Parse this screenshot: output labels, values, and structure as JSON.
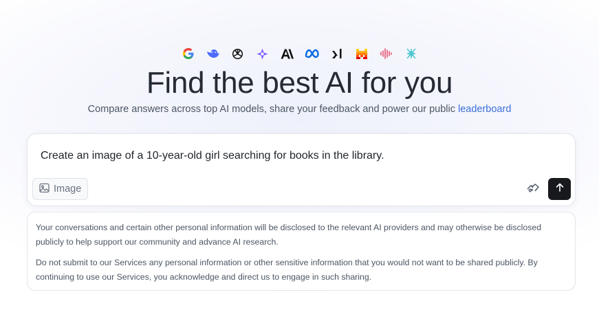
{
  "logos": [
    {
      "icon": "google-icon",
      "color": "#4285F4"
    },
    {
      "icon": "deepseek-icon",
      "color": "#4D6BFE"
    },
    {
      "icon": "openai-icon",
      "color": "#111111"
    },
    {
      "icon": "gemini-star-icon",
      "color": "#7C5CFF"
    },
    {
      "icon": "anthropic-icon",
      "color": "#111111"
    },
    {
      "icon": "meta-icon",
      "color": "#0668E1"
    },
    {
      "icon": "xai-icon",
      "color": "#111111"
    },
    {
      "icon": "mistral-icon",
      "color": "#F7A21B"
    },
    {
      "icon": "audio-wave-icon",
      "color": "#E5536F"
    },
    {
      "icon": "qwen-icon",
      "color": "#4DC6CF"
    }
  ],
  "title": "Find the best AI for you",
  "subtitle": {
    "text": "Compare answers across top AI models, share your feedback and power our public ",
    "link": "leaderboard"
  },
  "composer": {
    "prompt": "Create an image of a 10-year-old girl searching for books in the library.",
    "image_button": "Image"
  },
  "disclaimer": {
    "p1": "Your conversations and certain other personal information will be disclosed to the relevant AI providers and may otherwise be disclosed publicly to help support our community and advance AI research.",
    "p2": "Do not submit to our Services any personal information or other sensitive information that you would not want to be shared publicly. By continuing to use our Services, you acknowledge and direct us to engage in such sharing."
  },
  "colors": {
    "link": "#3b6fd8",
    "send_button": "#17191d"
  }
}
